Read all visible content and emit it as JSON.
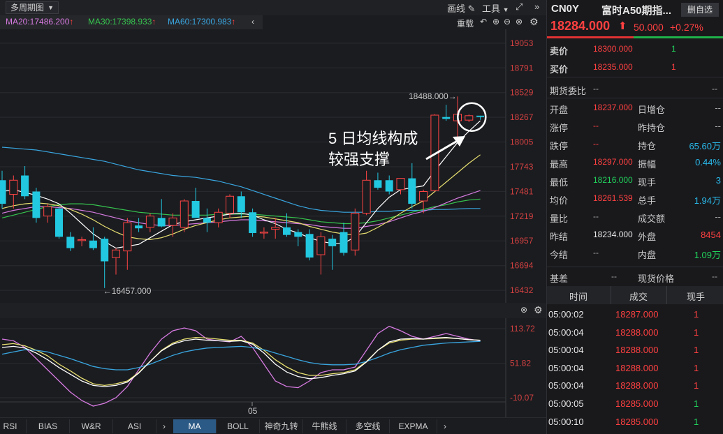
{
  "toolbar": {
    "period_label": "多周期图",
    "draw_label": "画线",
    "tools_label": "工具",
    "expand_icon": "expand-icon",
    "collapse_icon": "double-chevron-right-icon"
  },
  "ma_legend": [
    {
      "label": "MA20:17486.200",
      "color": "#d67ae0"
    },
    {
      "label": "MA30:17398.933",
      "color": "#36c44e"
    },
    {
      "label": "MA60:17300.983",
      "color": "#39a6e0"
    }
  ],
  "chart_tools": {
    "reload_label": "重载"
  },
  "annotation": {
    "line1": "5 日均线构成",
    "line2": "较强支撑"
  },
  "chart_data": [
    {
      "type": "candlestick",
      "title": "",
      "ylim": [
        16300,
        19200
      ],
      "y_ticks": [
        19053,
        18791,
        18529,
        18267,
        18005,
        17743,
        17481,
        17219,
        16957,
        16694,
        16432
      ],
      "high_label": "18488.000",
      "low_label": "16457.000",
      "candles": [
        {
          "o": 17600,
          "h": 17700,
          "l": 17300,
          "c": 17350
        },
        {
          "o": 17450,
          "h": 17650,
          "l": 17300,
          "c": 17600
        },
        {
          "o": 17650,
          "h": 17750,
          "l": 17400,
          "c": 17430
        },
        {
          "o": 17480,
          "h": 17520,
          "l": 17150,
          "c": 17200
        },
        {
          "o": 17220,
          "h": 17350,
          "l": 17150,
          "c": 17320
        },
        {
          "o": 17300,
          "h": 17320,
          "l": 16980,
          "c": 17000
        },
        {
          "o": 17000,
          "h": 17050,
          "l": 16850,
          "c": 16880
        },
        {
          "o": 16960,
          "h": 17000,
          "l": 16900,
          "c": 16970
        },
        {
          "o": 16960,
          "h": 17100,
          "l": 16860,
          "c": 16880
        },
        {
          "o": 16980,
          "h": 17000,
          "l": 16457,
          "c": 16740
        },
        {
          "o": 16780,
          "h": 16880,
          "l": 16600,
          "c": 16860
        },
        {
          "o": 16850,
          "h": 17200,
          "l": 16650,
          "c": 17150
        },
        {
          "o": 17120,
          "h": 17200,
          "l": 17050,
          "c": 17090
        },
        {
          "o": 17100,
          "h": 17250,
          "l": 17050,
          "c": 17220
        },
        {
          "o": 17200,
          "h": 17400,
          "l": 17100,
          "c": 17110
        },
        {
          "o": 17120,
          "h": 17250,
          "l": 17000,
          "c": 17200
        },
        {
          "o": 17100,
          "h": 17400,
          "l": 17050,
          "c": 17380
        },
        {
          "o": 17380,
          "h": 17520,
          "l": 17200,
          "c": 17200
        },
        {
          "o": 17200,
          "h": 17300,
          "l": 17050,
          "c": 17150
        },
        {
          "o": 17150,
          "h": 17300,
          "l": 17100,
          "c": 17260
        },
        {
          "o": 17250,
          "h": 17450,
          "l": 17200,
          "c": 17430
        },
        {
          "o": 17430,
          "h": 17480,
          "l": 17200,
          "c": 17260
        },
        {
          "o": 17260,
          "h": 17300,
          "l": 17000,
          "c": 17040
        },
        {
          "o": 17040,
          "h": 17100,
          "l": 16980,
          "c": 17050
        },
        {
          "o": 17080,
          "h": 17200,
          "l": 16980,
          "c": 17100
        },
        {
          "o": 17100,
          "h": 17250,
          "l": 17000,
          "c": 17020
        },
        {
          "o": 17050,
          "h": 17080,
          "l": 16900,
          "c": 17000
        },
        {
          "o": 17030,
          "h": 17080,
          "l": 16750,
          "c": 16780
        },
        {
          "o": 16810,
          "h": 17050,
          "l": 16600,
          "c": 17000
        },
        {
          "o": 16980,
          "h": 17020,
          "l": 16650,
          "c": 16900
        },
        {
          "o": 17050,
          "h": 17150,
          "l": 16800,
          "c": 16830
        },
        {
          "o": 16860,
          "h": 17300,
          "l": 16800,
          "c": 17250
        },
        {
          "o": 17250,
          "h": 17700,
          "l": 17230,
          "c": 17600
        },
        {
          "o": 17600,
          "h": 17680,
          "l": 17500,
          "c": 17520
        },
        {
          "o": 17600,
          "h": 17650,
          "l": 17450,
          "c": 17480
        },
        {
          "o": 17500,
          "h": 17600,
          "l": 17450,
          "c": 17620
        },
        {
          "o": 17620,
          "h": 17780,
          "l": 17300,
          "c": 17350
        },
        {
          "o": 17380,
          "h": 17500,
          "l": 17250,
          "c": 17480
        },
        {
          "o": 17490,
          "h": 18300,
          "l": 17480,
          "c": 18290
        },
        {
          "o": 18270,
          "h": 18400,
          "l": 18230,
          "c": 18250
        },
        {
          "o": 18230,
          "h": 18488,
          "l": 18050,
          "c": 18300
        },
        {
          "o": 18237,
          "h": 18297,
          "l": 18216,
          "c": 18284
        },
        {
          "o": 18284,
          "h": 18284,
          "l": 18240,
          "c": 18270
        }
      ],
      "ma5": [
        17480,
        17500,
        17470,
        17440,
        17400,
        17350,
        17250,
        17140,
        17030,
        16950,
        16880,
        16900,
        16920,
        16990,
        17060,
        17130,
        17160,
        17180,
        17200,
        17220,
        17240,
        17250,
        17230,
        17180,
        17140,
        17080,
        17040,
        16990,
        16950,
        16930,
        16930,
        17000,
        17150,
        17300,
        17420,
        17500,
        17520,
        17540,
        17700,
        17850,
        18000,
        18120,
        18230
      ],
      "ma10": [
        17300,
        17330,
        17350,
        17360,
        17350,
        17330,
        17290,
        17240,
        17180,
        17110,
        17050,
        17000,
        16980,
        16970,
        16990,
        17030,
        17080,
        17120,
        17150,
        17180,
        17200,
        17210,
        17220,
        17210,
        17190,
        17170,
        17150,
        17110,
        17080,
        17050,
        17030,
        17020,
        17040,
        17100,
        17170,
        17250,
        17320,
        17380,
        17480,
        17580,
        17680,
        17780,
        17870
      ],
      "ma20": [
        17250,
        17280,
        17300,
        17320,
        17320,
        17310,
        17300,
        17280,
        17260,
        17230,
        17200,
        17170,
        17150,
        17130,
        17120,
        17120,
        17130,
        17140,
        17150,
        17160,
        17170,
        17180,
        17180,
        17170,
        17160,
        17150,
        17140,
        17130,
        17110,
        17100,
        17090,
        17090,
        17110,
        17130,
        17160,
        17200,
        17240,
        17270,
        17310,
        17360,
        17410,
        17450,
        17490
      ],
      "ma30": [
        17200,
        17230,
        17260,
        17290,
        17320,
        17340,
        17350,
        17350,
        17340,
        17320,
        17300,
        17280,
        17260,
        17250,
        17240,
        17230,
        17230,
        17230,
        17230,
        17240,
        17240,
        17240,
        17240,
        17230,
        17220,
        17210,
        17200,
        17180,
        17160,
        17150,
        17140,
        17140,
        17150,
        17170,
        17200,
        17230,
        17260,
        17290,
        17320,
        17340,
        17370,
        17390,
        17400
      ],
      "ma60": [
        17950,
        17940,
        17930,
        17920,
        17900,
        17880,
        17860,
        17840,
        17820,
        17800,
        17770,
        17740,
        17710,
        17690,
        17670,
        17650,
        17640,
        17630,
        17610,
        17590,
        17560,
        17530,
        17490,
        17450,
        17410,
        17370,
        17330,
        17300,
        17280,
        17270,
        17260,
        17260,
        17260,
        17270,
        17270,
        17280,
        17280,
        17280,
        17290,
        17290,
        17295,
        17300,
        17300
      ]
    },
    {
      "type": "line",
      "title": "",
      "ylim": [
        -25,
        125
      ],
      "y_ticks": [
        113.72,
        51.82,
        -10.07
      ],
      "x_tick_label": "05",
      "series": [
        {
          "color": "#d67ae0",
          "values": [
            95,
            92,
            80,
            60,
            40,
            20,
            0,
            -15,
            -25,
            -20,
            -10,
            10,
            40,
            70,
            95,
            110,
            115,
            110,
            95,
            92,
            90,
            100,
            80,
            50,
            20,
            10,
            8,
            20,
            35,
            40,
            40,
            45,
            75,
            105,
            118,
            110,
            100,
            95,
            100,
            105,
            100,
            95,
            92
          ]
        },
        {
          "color": "#e8e070",
          "values": [
            85,
            87,
            83,
            75,
            65,
            50,
            38,
            25,
            15,
            12,
            15,
            20,
            35,
            55,
            75,
            88,
            95,
            98,
            97,
            95,
            93,
            93,
            88,
            75,
            58,
            45,
            35,
            30,
            30,
            33,
            35,
            40,
            55,
            75,
            88,
            93,
            95,
            95,
            96,
            97,
            96,
            94,
            93
          ]
        },
        {
          "color": "#39a6e0",
          "values": [
            68,
            72,
            76,
            75,
            72,
            66,
            60,
            53,
            46,
            42,
            40,
            40,
            44,
            50,
            58,
            66,
            72,
            76,
            79,
            80,
            81,
            82,
            80,
            76,
            70,
            64,
            58,
            53,
            50,
            49,
            49,
            50,
            55,
            62,
            70,
            76,
            80,
            84,
            86,
            88,
            89,
            90,
            91
          ]
        },
        {
          "color": "#ffffff",
          "values": [
            80,
            82,
            79,
            70,
            58,
            44,
            32,
            20,
            12,
            10,
            12,
            18,
            34,
            55,
            74,
            86,
            92,
            95,
            93,
            92,
            91,
            92,
            86,
            70,
            50,
            36,
            28,
            24,
            26,
            30,
            33,
            38,
            54,
            75,
            90,
            95,
            96,
            95,
            97,
            98,
            96,
            94,
            93
          ]
        }
      ]
    }
  ],
  "indicator_tabs": [
    "RSI",
    "BIAS",
    "W&R",
    "ASI",
    "MA",
    "BOLL",
    "神奇九转",
    "牛熊线",
    "多空线",
    "EXPMA"
  ],
  "indicator_active": "MA",
  "quote": {
    "code": "CN0Y",
    "name": "富时A50期指...",
    "add_label": "删自选",
    "price": "18284.000",
    "change": "50.000",
    "change_pct": "+0.27%",
    "ask_label": "卖价",
    "ask": "18300.000",
    "ask_vol": "1",
    "bid_label": "买价",
    "bid": "18235.000",
    "bid_vol": "1",
    "ratio_label": "期货委比",
    "ratio": "--",
    "ratio_r": "--",
    "stats": [
      {
        "l1": "开盘",
        "v1": "18237.000",
        "c1": "red",
        "l2": "日增仓",
        "v2": "--",
        "c2": "gray"
      },
      {
        "l1": "涨停",
        "v1": "--",
        "c1": "red",
        "l2": "昨持仓",
        "v2": "--",
        "c2": "gray"
      },
      {
        "l1": "跌停",
        "v1": "--",
        "c1": "red",
        "l2": "持仓",
        "v2": "65.60万",
        "c2": "cyan"
      },
      {
        "l1": "最高",
        "v1": "18297.000",
        "c1": "red",
        "l2": "振幅",
        "v2": "0.44%",
        "c2": "cyan"
      },
      {
        "l1": "最低",
        "v1": "18216.000",
        "c1": "green",
        "l2": "现手",
        "v2": "3",
        "c2": "cyan"
      },
      {
        "l1": "均价",
        "v1": "18261.539",
        "c1": "red",
        "l2": "总手",
        "v2": "1.94万",
        "c2": "cyan"
      },
      {
        "l1": "量比",
        "v1": "--",
        "c1": "gray",
        "l2": "成交额",
        "v2": "--",
        "c2": "gray"
      },
      {
        "l1": "昨结",
        "v1": "18234.000",
        "c1": "white",
        "l2": "外盘",
        "v2": "8454",
        "c2": "red"
      },
      {
        "l1": "今结",
        "v1": "--",
        "c1": "gray",
        "l2": "内盘",
        "v2": "1.09万",
        "c2": "green"
      }
    ],
    "basis_label": "基差",
    "basis": "--",
    "spot_label": "现货价格",
    "spot": "--"
  },
  "trades": {
    "headers": [
      "时间",
      "成交",
      "现手"
    ],
    "rows": [
      {
        "time": "05:00:02",
        "price": "18287.000",
        "vol": "1",
        "vc": "red"
      },
      {
        "time": "05:00:04",
        "price": "18288.000",
        "vol": "1",
        "vc": "red"
      },
      {
        "time": "05:00:04",
        "price": "18288.000",
        "vol": "1",
        "vc": "red"
      },
      {
        "time": "05:00:04",
        "price": "18288.000",
        "vol": "1",
        "vc": "red"
      },
      {
        "time": "05:00:04",
        "price": "18288.000",
        "vol": "1",
        "vc": "red"
      },
      {
        "time": "05:00:05",
        "price": "18285.000",
        "vol": "1",
        "vc": "green"
      },
      {
        "time": "05:00:10",
        "price": "18285.000",
        "vol": "1",
        "vc": "green"
      }
    ]
  }
}
